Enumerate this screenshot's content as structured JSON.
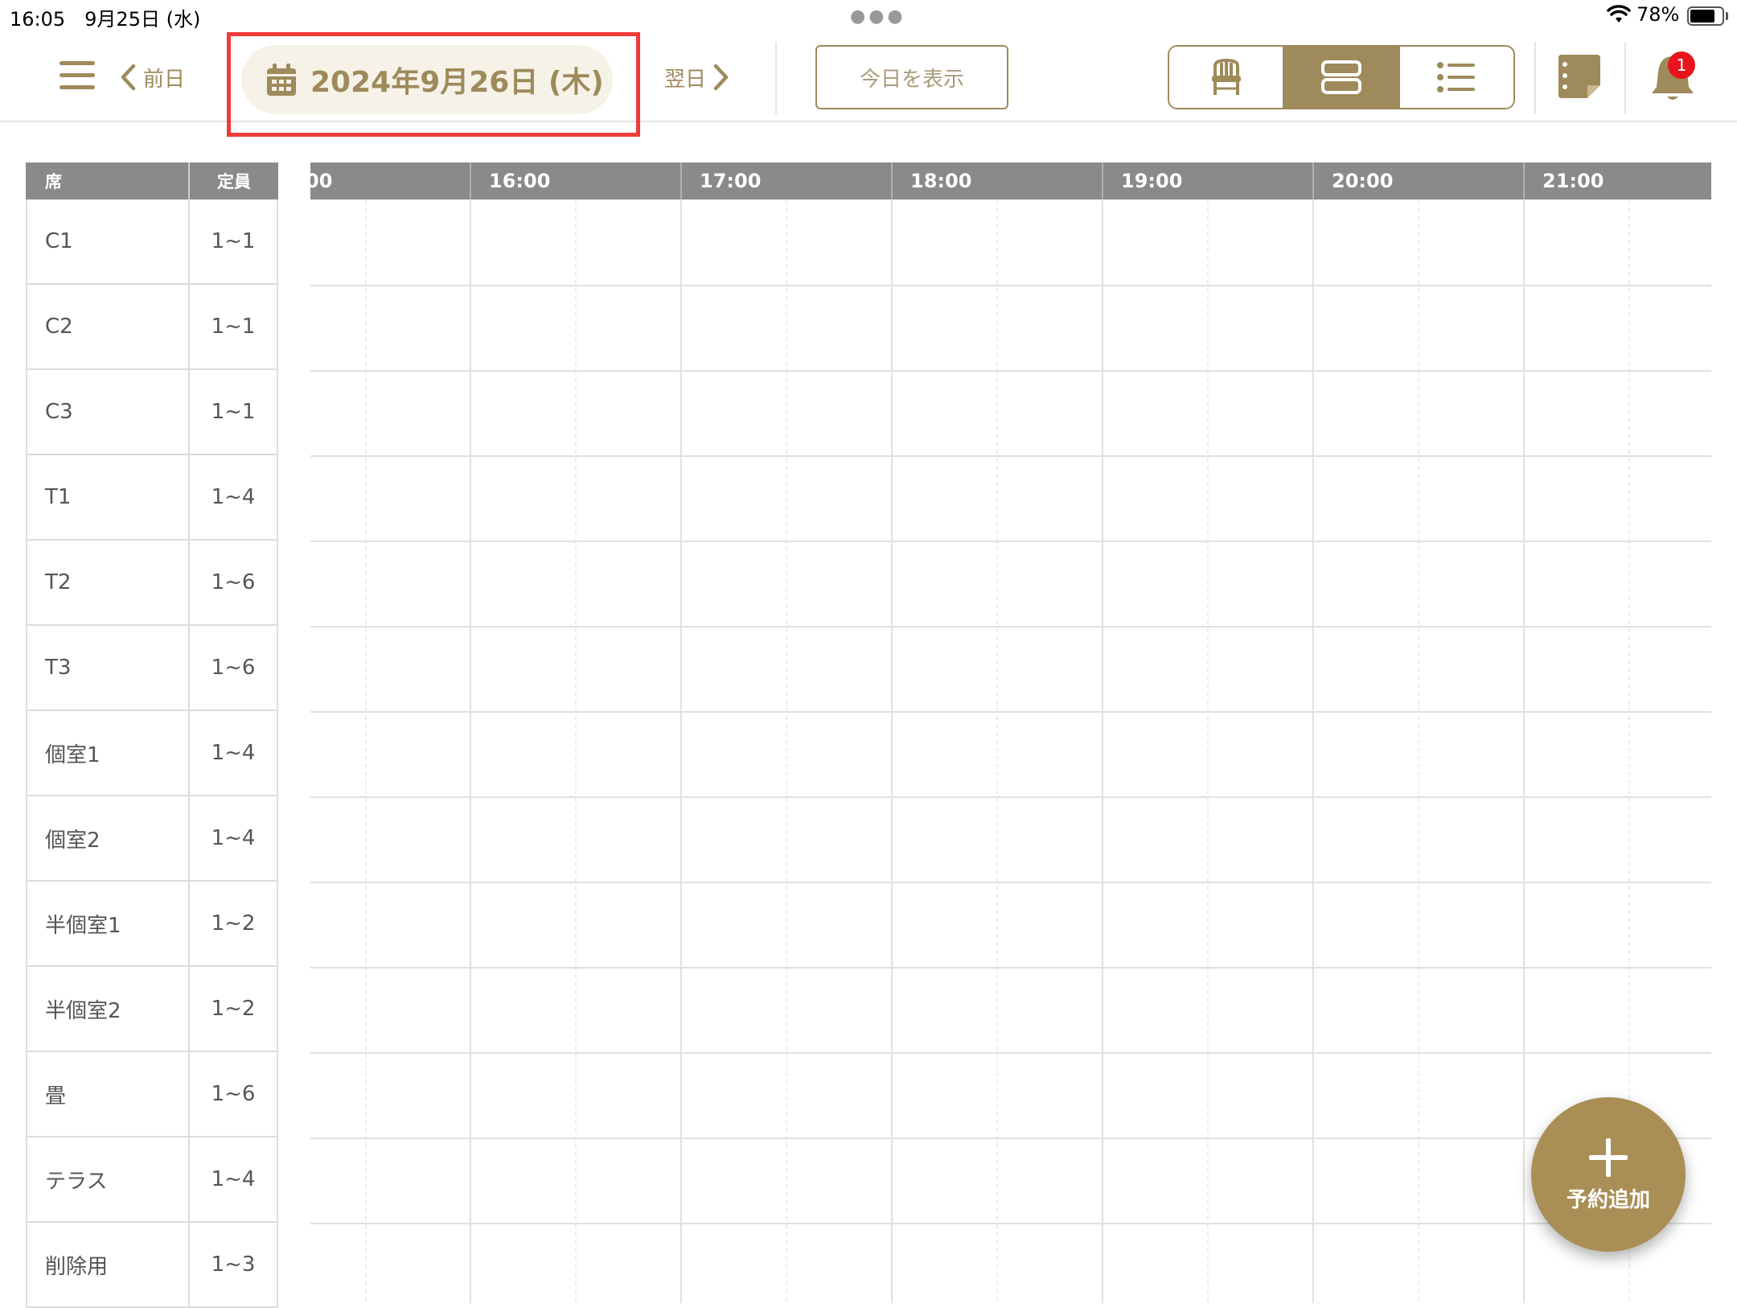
{
  "status_bar": {
    "time_date": "16:05　9月25日 (水)",
    "battery": "78%"
  },
  "header": {
    "prev_label": "前日",
    "date": "2024年9月26日 (木)",
    "next_label": "翌日",
    "today_label": "今日を表示",
    "notification_count": "1",
    "accent_color": "#9e8a5a"
  },
  "seat_table": {
    "col_seat": "席",
    "col_capacity": "定員",
    "rows": [
      {
        "seat": "C1",
        "capacity": "1~1"
      },
      {
        "seat": "C2",
        "capacity": "1~1"
      },
      {
        "seat": "C3",
        "capacity": "1~1"
      },
      {
        "seat": "T1",
        "capacity": "1~4"
      },
      {
        "seat": "T2",
        "capacity": "1~6"
      },
      {
        "seat": "T3",
        "capacity": "1~6"
      },
      {
        "seat": "個室1",
        "capacity": "1~4"
      },
      {
        "seat": "個室2",
        "capacity": "1~4"
      },
      {
        "seat": "半個室1",
        "capacity": "1~2"
      },
      {
        "seat": "半個室2",
        "capacity": "1~2"
      },
      {
        "seat": "畳",
        "capacity": "1~6"
      },
      {
        "seat": "テラス",
        "capacity": "1~4"
      },
      {
        "seat": "削除用",
        "capacity": "1~3"
      }
    ]
  },
  "timeline": {
    "hours": [
      "00",
      "16:00",
      "17:00",
      "18:00",
      "19:00",
      "20:00",
      "21:00"
    ]
  },
  "fab": {
    "label": "予約追加"
  }
}
